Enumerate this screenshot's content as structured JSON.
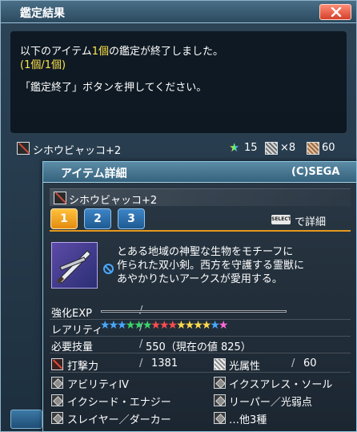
{
  "dialog": {
    "title": "鑑定結果",
    "message_prefix": "以下のアイテム",
    "message_count": "1個",
    "message_suffix": "の鑑定が終了しました。",
    "progress": "(1個/1個)",
    "instruction": "「鑑定終了」ボタンを押してください。"
  },
  "result": {
    "item_name": "シホウビャッコ+2",
    "rarity": "15",
    "unit_slots": "×8",
    "fix_value": "60"
  },
  "detail": {
    "title": "アイテム詳細",
    "copyright": "(C)SEGA",
    "item_name": "シホウビャッコ+2",
    "tabs": [
      "1",
      "2",
      "3"
    ],
    "select_key": "SELECT",
    "select_hint": "で詳細",
    "description": [
      "とある地域の神聖な生物をモチーフに",
      "作られた双小剣。西方を守護する霊獣に",
      "あやかりたいアークスが愛用する。"
    ],
    "enhance_exp_label": "強化EXP",
    "rarity_label": "レアリティ",
    "rarity_stars": 15,
    "rarity_colors": [
      "#4aa8ff",
      "#4aa8ff",
      "#4aa8ff",
      "#3cd46a",
      "#3cd46a",
      "#3cd46a",
      "#ff4d4d",
      "#ff4d4d",
      "#ff4d4d",
      "#ffd94d",
      "#ffd94d",
      "#ffd94d",
      "#ffd94d",
      "#4aa8ff",
      "#ff6ad4"
    ],
    "requirement_label": "必要技量",
    "requirement_value": "550（現在の値 825）",
    "attack_label": "打撃力",
    "attack_value": "1381",
    "element_label": "光属性",
    "element_value": "60",
    "abilities": [
      "アビリティIV",
      "イクスアレス・ソール",
      "イクシード・エナジー",
      "リーパー／光弱点",
      "スレイヤー／ダーカー",
      "…他3種"
    ]
  }
}
